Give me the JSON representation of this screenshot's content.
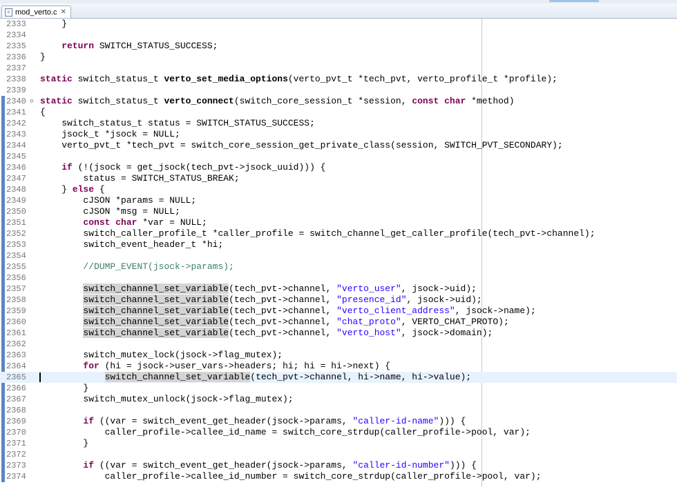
{
  "tab": {
    "title": "mod_verto.c",
    "close_symbol": "✕"
  },
  "lines": [
    {
      "n": "2333",
      "segs": [
        [
          "t",
          "    }"
        ]
      ]
    },
    {
      "n": "2334",
      "segs": []
    },
    {
      "n": "2335",
      "segs": [
        [
          "t",
          "    "
        ],
        [
          "kw",
          "return"
        ],
        [
          "t",
          " SWITCH_STATUS_SUCCESS;"
        ]
      ]
    },
    {
      "n": "2336",
      "segs": [
        [
          "t",
          "}"
        ]
      ]
    },
    {
      "n": "2337",
      "segs": []
    },
    {
      "n": "2338",
      "segs": [
        [
          "kw",
          "static"
        ],
        [
          "t",
          " switch_status_t "
        ],
        [
          "fn",
          "verto_set_media_options"
        ],
        [
          "t",
          "(verto_pvt_t *tech_pvt, verto_profile_t *profile);"
        ]
      ]
    },
    {
      "n": "2339",
      "segs": []
    },
    {
      "n": "2340",
      "fold": "⊖",
      "segs": [
        [
          "kw",
          "static"
        ],
        [
          "t",
          " switch_status_t "
        ],
        [
          "fn",
          "verto_connect"
        ],
        [
          "t",
          "(switch_core_session_t *session, "
        ],
        [
          "kw",
          "const char"
        ],
        [
          "t",
          " *method)"
        ]
      ]
    },
    {
      "n": "2341",
      "segs": [
        [
          "t",
          "{"
        ]
      ]
    },
    {
      "n": "2342",
      "segs": [
        [
          "t",
          "    switch_status_t status = SWITCH_STATUS_SUCCESS;"
        ]
      ]
    },
    {
      "n": "2343",
      "segs": [
        [
          "t",
          "    jsock_t *jsock = NULL;"
        ]
      ]
    },
    {
      "n": "2344",
      "segs": [
        [
          "t",
          "    verto_pvt_t *tech_pvt = switch_core_session_get_private_class(session, SWITCH_PVT_SECONDARY);"
        ]
      ]
    },
    {
      "n": "2345",
      "segs": []
    },
    {
      "n": "2346",
      "segs": [
        [
          "t",
          "    "
        ],
        [
          "kw",
          "if"
        ],
        [
          "t",
          " (!(jsock = get_jsock(tech_pvt->jsock_uuid))) {"
        ]
      ]
    },
    {
      "n": "2347",
      "segs": [
        [
          "t",
          "        status = SWITCH_STATUS_BREAK;"
        ]
      ]
    },
    {
      "n": "2348",
      "segs": [
        [
          "t",
          "    } "
        ],
        [
          "kw",
          "else"
        ],
        [
          "t",
          " {"
        ]
      ]
    },
    {
      "n": "2349",
      "segs": [
        [
          "t",
          "        cJSON *params = NULL;"
        ]
      ]
    },
    {
      "n": "2350",
      "segs": [
        [
          "t",
          "        cJSON *msg = NULL;"
        ]
      ]
    },
    {
      "n": "2351",
      "segs": [
        [
          "t",
          "        "
        ],
        [
          "kw",
          "const char"
        ],
        [
          "t",
          " *var = NULL;"
        ]
      ]
    },
    {
      "n": "2352",
      "segs": [
        [
          "t",
          "        switch_caller_profile_t *caller_profile = switch_channel_get_caller_profile(tech_pvt->channel);"
        ]
      ]
    },
    {
      "n": "2353",
      "segs": [
        [
          "t",
          "        switch_event_header_t *hi;"
        ]
      ]
    },
    {
      "n": "2354",
      "segs": []
    },
    {
      "n": "2355",
      "segs": [
        [
          "t",
          "        "
        ],
        [
          "cm",
          "//DUMP_EVENT(jsock->params);"
        ]
      ]
    },
    {
      "n": "2356",
      "segs": []
    },
    {
      "n": "2357",
      "segs": [
        [
          "t",
          "        "
        ],
        [
          "occ",
          "switch_channel_set_variable"
        ],
        [
          "t",
          "(tech_pvt->channel, "
        ],
        [
          "str",
          "\"verto_user\""
        ],
        [
          "t",
          ", jsock->uid);"
        ]
      ]
    },
    {
      "n": "2358",
      "segs": [
        [
          "t",
          "        "
        ],
        [
          "occ",
          "switch_channel_set_variable"
        ],
        [
          "t",
          "(tech_pvt->channel, "
        ],
        [
          "str",
          "\"presence_id\""
        ],
        [
          "t",
          ", jsock->uid);"
        ]
      ]
    },
    {
      "n": "2359",
      "segs": [
        [
          "t",
          "        "
        ],
        [
          "occ",
          "switch_channel_set_variable"
        ],
        [
          "t",
          "(tech_pvt->channel, "
        ],
        [
          "str",
          "\"verto_client_address\""
        ],
        [
          "t",
          ", jsock->name);"
        ]
      ]
    },
    {
      "n": "2360",
      "segs": [
        [
          "t",
          "        "
        ],
        [
          "occ",
          "switch_channel_set_variable"
        ],
        [
          "t",
          "(tech_pvt->channel, "
        ],
        [
          "str",
          "\"chat_proto\""
        ],
        [
          "t",
          ", VERTO_CHAT_PROTO);"
        ]
      ]
    },
    {
      "n": "2361",
      "segs": [
        [
          "t",
          "        "
        ],
        [
          "occ",
          "switch_channel_set_variable"
        ],
        [
          "t",
          "(tech_pvt->channel, "
        ],
        [
          "str",
          "\"verto_host\""
        ],
        [
          "t",
          ", jsock->domain);"
        ]
      ]
    },
    {
      "n": "2362",
      "segs": []
    },
    {
      "n": "2363",
      "segs": [
        [
          "t",
          "        switch_mutex_lock(jsock->flag_mutex);"
        ]
      ]
    },
    {
      "n": "2364",
      "segs": [
        [
          "t",
          "        "
        ],
        [
          "kw",
          "for"
        ],
        [
          "t",
          " (hi = jsock->user_vars->headers; hi; hi = hi->next) {"
        ]
      ]
    },
    {
      "n": "2365",
      "current": true,
      "segs": [
        [
          "t",
          "            "
        ],
        [
          "occ",
          "switch_channel_set_variable"
        ],
        [
          "t",
          "(tech_pvt->channel, hi->name, hi->value);"
        ]
      ]
    },
    {
      "n": "2366",
      "segs": [
        [
          "t",
          "        }"
        ]
      ]
    },
    {
      "n": "2367",
      "segs": [
        [
          "t",
          "        switch_mutex_unlock(jsock->flag_mutex);"
        ]
      ]
    },
    {
      "n": "2368",
      "segs": []
    },
    {
      "n": "2369",
      "segs": [
        [
          "t",
          "        "
        ],
        [
          "kw",
          "if"
        ],
        [
          "t",
          " ((var = switch_event_get_header(jsock->params, "
        ],
        [
          "str",
          "\"caller-id-name\""
        ],
        [
          "t",
          "))) {"
        ]
      ]
    },
    {
      "n": "2370",
      "segs": [
        [
          "t",
          "            caller_profile->callee_id_name = switch_core_strdup(caller_profile->pool, var);"
        ]
      ]
    },
    {
      "n": "2371",
      "segs": [
        [
          "t",
          "        }"
        ]
      ]
    },
    {
      "n": "2372",
      "segs": []
    },
    {
      "n": "2373",
      "segs": [
        [
          "t",
          "        "
        ],
        [
          "kw",
          "if"
        ],
        [
          "t",
          " ((var = switch_event_get_header(jsock->params, "
        ],
        [
          "str",
          "\"caller-id-number\""
        ],
        [
          "t",
          "))) {"
        ]
      ]
    },
    {
      "n": "2374",
      "segs": [
        [
          "t",
          "            caller_profile->callee_id_number = switch_core_strdup(caller_profile->pool, var);"
        ]
      ]
    }
  ]
}
